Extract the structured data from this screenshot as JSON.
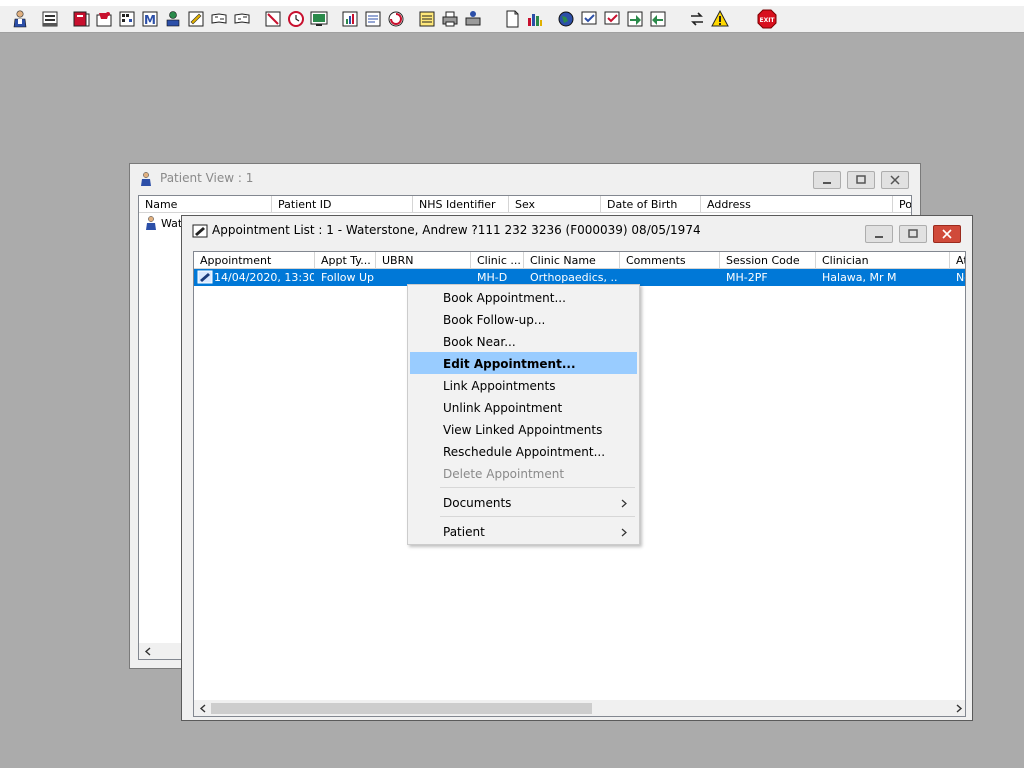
{
  "toolbar": {
    "icons": [
      "patient-icon",
      "list-icon",
      "book-icon",
      "folder-icon",
      "schedule-icon",
      "letter-m-icon",
      "person-icon",
      "form-icon",
      "flag-icon",
      "flag-icon",
      "no-entry-icon",
      "clock-icon",
      "monitor-icon",
      "chart-icon",
      "note-icon",
      "refresh-icon",
      "notepad-icon",
      "printer-icon",
      "printer-person-icon",
      "document-icon",
      "bar-chart-icon",
      "globe-icon",
      "check-list-icon",
      "check-icon",
      "green-arrow-icon",
      "green-arrow-icon",
      "swap-icon",
      "warning-icon",
      "exit-icon"
    ],
    "exit_label": "EXIT"
  },
  "patient_view": {
    "title": "Patient View : 1",
    "columns": [
      "Name",
      "Patient ID",
      "NHS Identifier",
      "Sex",
      "Date of Birth",
      "Address",
      "Po"
    ],
    "row_name": "Wat"
  },
  "appointment_list": {
    "title": "Appointment List : 1 - Waterstone, Andrew ?111 232 3236 (F000039) 08/05/1974",
    "columns": [
      "Appointment",
      "Appt Ty...",
      "UBRN",
      "Clinic ...",
      "Clinic Name",
      "Comments",
      "Session Code",
      "Clinician",
      "At"
    ],
    "row": {
      "appointment": "14/04/2020, 13:30",
      "appt_type": "Follow Up",
      "ubrn": "",
      "clinic": "MH-D",
      "clinic_name": "Orthopaedics, ...",
      "comments": "",
      "session_code": "MH-2PF",
      "clinician": "Halawa, Mr M",
      "at": "No"
    }
  },
  "context_menu": {
    "items": [
      {
        "label": "Book Appointment...",
        "state": "normal"
      },
      {
        "label": "Book Follow-up...",
        "state": "normal"
      },
      {
        "label": "Book Near...",
        "state": "normal"
      },
      {
        "label": "Edit Appointment...",
        "state": "highlighted"
      },
      {
        "label": "Link Appointments",
        "state": "normal"
      },
      {
        "label": "Unlink Appointment",
        "state": "normal"
      },
      {
        "label": "View Linked Appointments",
        "state": "normal"
      },
      {
        "label": "Reschedule Appointment...",
        "state": "normal"
      },
      {
        "label": "Delete Appointment",
        "state": "disabled"
      },
      {
        "label": "Documents",
        "state": "submenu"
      },
      {
        "label": "Patient",
        "state": "submenu"
      }
    ]
  },
  "colors": {
    "desktop": "#ababab",
    "selection": "#0078d7",
    "menu_highlight": "#99ccff"
  }
}
